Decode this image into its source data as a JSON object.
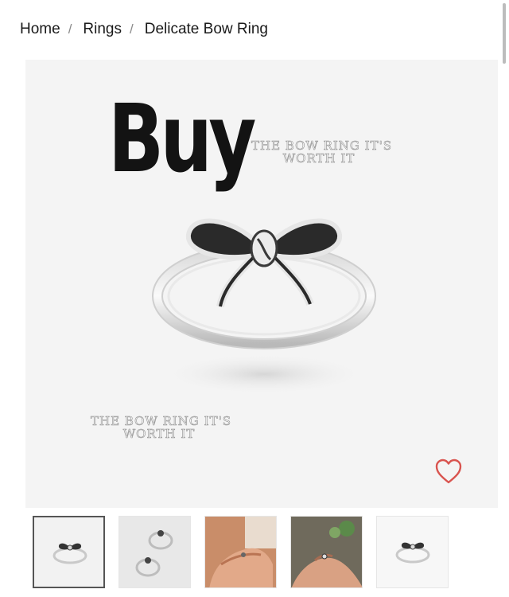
{
  "breadcrumb": {
    "items": [
      "Home",
      "Rings",
      "Delicate Bow Ring"
    ],
    "separator": "/"
  },
  "hero": {
    "headline": "Buy",
    "tagline_line1": "THE BOW RING IT'S",
    "tagline_line2": "WORTH IT",
    "background": "#f4f4f4"
  },
  "wishlist": {
    "icon": "heart-outline-icon",
    "color": "#d9544f"
  },
  "thumbnails": [
    {
      "name": "ring-front",
      "active": true
    },
    {
      "name": "two-rings",
      "active": false
    },
    {
      "name": "ring-on-hand",
      "active": false
    },
    {
      "name": "ring-on-finger-outdoor",
      "active": false
    },
    {
      "name": "ring-detail",
      "active": false
    }
  ]
}
